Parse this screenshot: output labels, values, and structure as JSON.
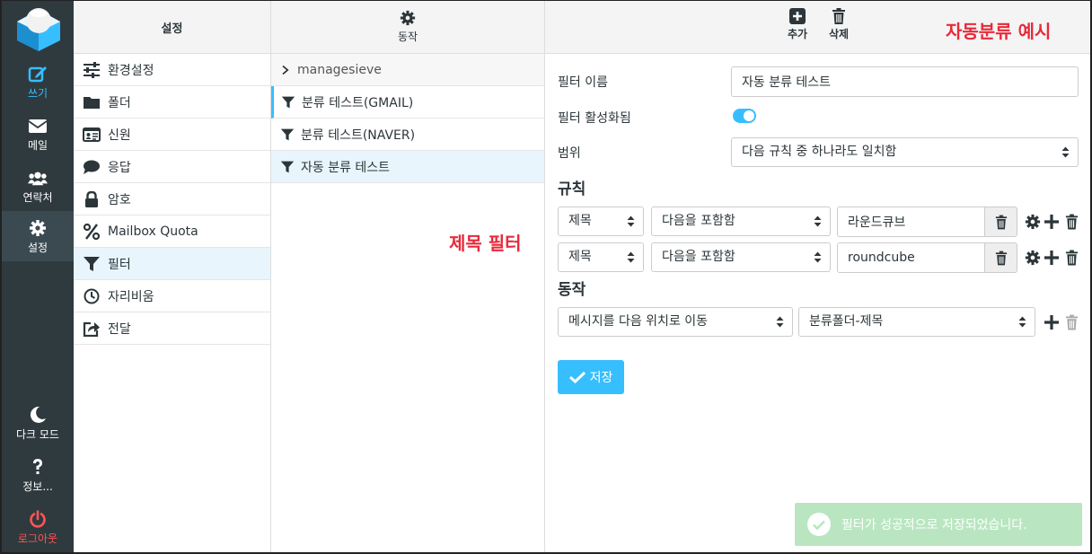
{
  "nav": {
    "compose": "쓰기",
    "mail": "메일",
    "contacts": "연락처",
    "settings": "설정",
    "dark_mode": "다크 모드",
    "about": "정보...",
    "logout": "로그아웃"
  },
  "settings_list": {
    "title": "설정",
    "items": [
      {
        "label": "환경설정",
        "icon": "sliders-icon"
      },
      {
        "label": "폴더",
        "icon": "folder-icon"
      },
      {
        "label": "신원",
        "icon": "id-card-icon"
      },
      {
        "label": "응답",
        "icon": "comment-icon"
      },
      {
        "label": "암호",
        "icon": "lock-icon"
      },
      {
        "label": "Mailbox Quota",
        "icon": "percent-icon"
      },
      {
        "label": "필터",
        "icon": "filter-icon"
      },
      {
        "label": "자리비움",
        "icon": "clock-icon"
      },
      {
        "label": "전달",
        "icon": "forward-icon"
      }
    ],
    "selected_index": 6
  },
  "filter_sets": {
    "action_label": "동작",
    "group": "managesieve",
    "items": [
      "분류 테스트(GMAIL)",
      "분류 테스트(NAVER)",
      "자동 분류 테스트"
    ],
    "selected_index": 2
  },
  "annotations": {
    "subject_filter": "제목 필터",
    "auto_example": "자동분류 예시"
  },
  "toolbar": {
    "add": "추가",
    "delete": "삭제"
  },
  "form": {
    "name_label": "필터 이름",
    "name_value": "자동 분류 테스트",
    "enabled_label": "필터 활성화됨",
    "enabled": true,
    "scope_label": "범위",
    "scope_value": "다음 규칙 중 하나라도 일치함",
    "rules_heading": "규칙",
    "rules": [
      {
        "header": "제목",
        "op": "다음을 포함함",
        "value": "라운드큐브"
      },
      {
        "header": "제목",
        "op": "다음을 포함함",
        "value": "roundcube"
      }
    ],
    "actions_heading": "동작",
    "action_type": "메시지를 다음 위치로 이동",
    "action_target": "분류폴더-제목",
    "save_label": "저장"
  },
  "toast": {
    "message": "필터가 성공적으로 저장되었습니다."
  },
  "colors": {
    "accent": "#37beff",
    "annotation": "#e8293b",
    "sidebar": "#2f3a3f"
  }
}
